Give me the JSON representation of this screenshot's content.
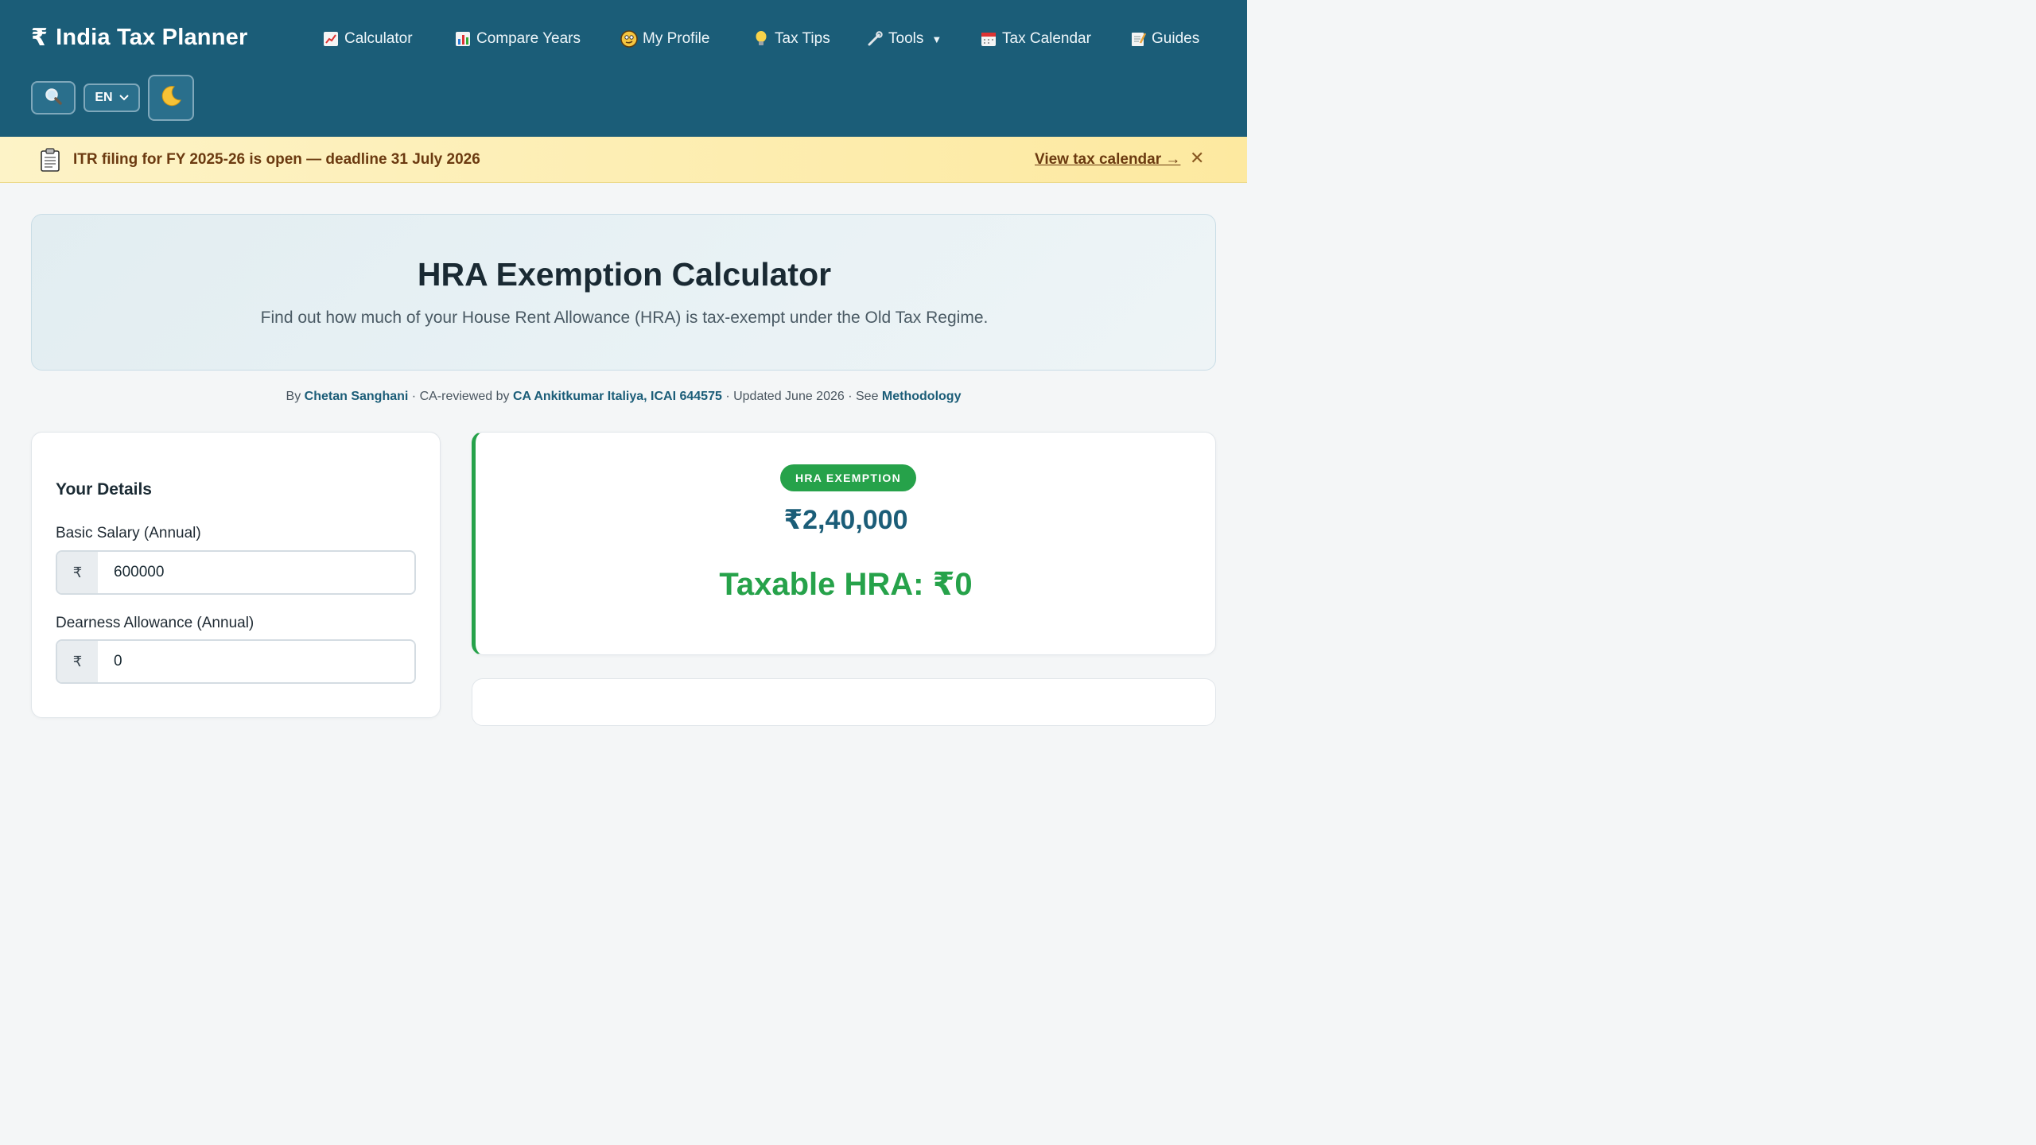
{
  "header": {
    "brand_symbol": "₹",
    "brand_name": "India Tax Planner",
    "nav": [
      {
        "label": "Calculator",
        "icon": "chart-up-icon"
      },
      {
        "label": "Compare Years",
        "icon": "bar-chart-icon"
      },
      {
        "label": "My Profile",
        "icon": "face-icon"
      },
      {
        "label": "Tax Tips",
        "icon": "lightbulb-icon"
      },
      {
        "label": "Tools",
        "icon": "wrench-icon",
        "caret": "▼"
      },
      {
        "label": "Tax Calendar",
        "icon": "calendar-icon"
      },
      {
        "label": "Guides",
        "icon": "memo-icon"
      }
    ],
    "language": "EN",
    "colors": {
      "header_bg": "#1b5d78",
      "accent_green": "#26a24a"
    }
  },
  "announcement": {
    "text": "ITR filing for FY 2025-26 is open — deadline 31 July 2026",
    "link": "View tax calendar →",
    "close": "✕"
  },
  "hero": {
    "title": "HRA Exemption Calculator",
    "subtitle": "Find out how much of your House Rent Allowance (HRA) is tax-exempt under the Old Tax Regime."
  },
  "byline": {
    "by": "By",
    "author": "Chetan Sanghani",
    "reviewed_prefix": "· CA-reviewed by",
    "reviewer": "CA Ankitkumar Italiya, ICAI 644575",
    "updated": "· Updated June 2026 · See",
    "methodology": "Methodology"
  },
  "details": {
    "heading": "Your Details",
    "fields": [
      {
        "label": "Basic Salary (Annual)",
        "prefix": "₹",
        "value": "600000"
      },
      {
        "label": "Dearness Allowance (Annual)",
        "prefix": "₹",
        "value": "0"
      }
    ]
  },
  "result": {
    "badge": "HRA EXEMPTION",
    "amount": "₹2,40,000",
    "taxable": "Taxable HRA: ₹0"
  }
}
